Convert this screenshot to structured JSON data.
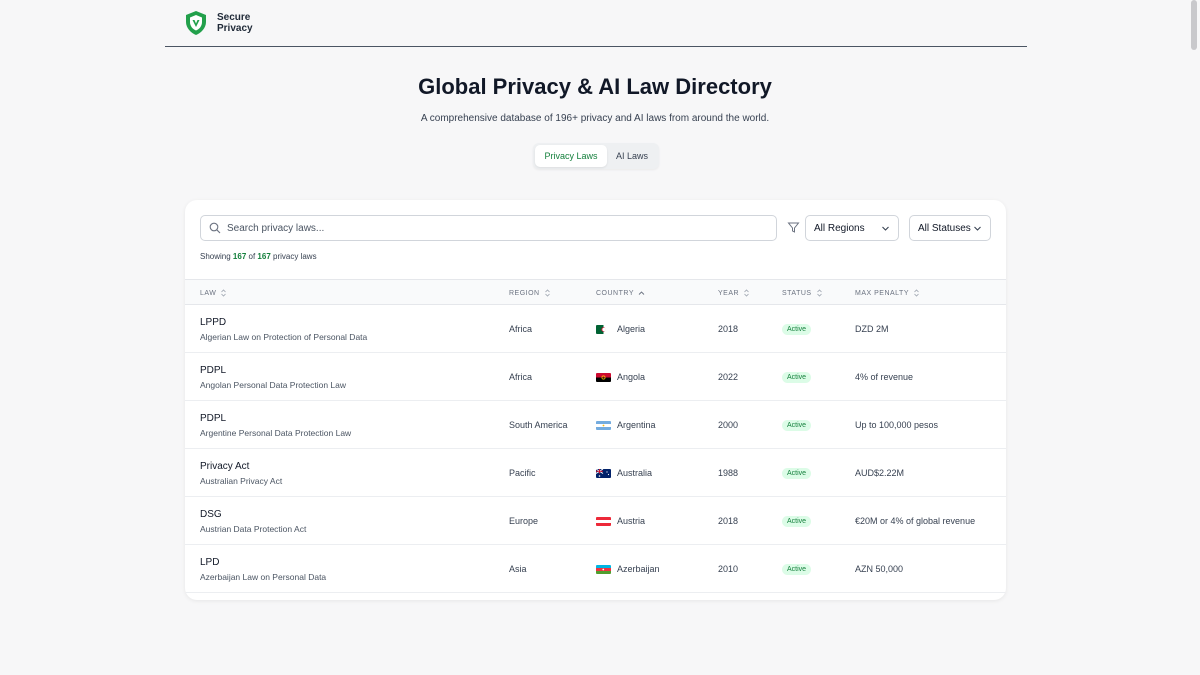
{
  "brand": {
    "line1": "Secure",
    "line2": "Privacy"
  },
  "hero": {
    "title": "Global Privacy & AI Law Directory",
    "subtitle": "A comprehensive database of 196+ privacy and AI laws from around the world."
  },
  "tabs": [
    {
      "label": "Privacy Laws",
      "active": true
    },
    {
      "label": "AI Laws",
      "active": false
    }
  ],
  "search": {
    "placeholder": "Search privacy laws..."
  },
  "filters": {
    "region": "All Regions",
    "status": "All Statuses"
  },
  "showing": {
    "prefix": "Showing",
    "shown": "167",
    "of": "of",
    "total": "167",
    "suffix": "privacy laws"
  },
  "columns": {
    "law": "LAW",
    "region": "REGION",
    "country": "COUNTRY",
    "year": "YEAR",
    "status": "STATUS",
    "penalty": "MAX PENALTY"
  },
  "colors": {
    "accent": "#15803d",
    "badge_bg": "#dcfce7"
  },
  "rows": [
    {
      "abbr": "LPPD",
      "name": "Algerian Law on Protection of Personal Data",
      "region": "Africa",
      "country": "Algeria",
      "flag": "algeria-flag",
      "year": "2018",
      "status": "Active",
      "penalty": "DZD 2M"
    },
    {
      "abbr": "PDPL",
      "name": "Angolan Personal Data Protection Law",
      "region": "Africa",
      "country": "Angola",
      "flag": "angola-flag",
      "year": "2022",
      "status": "Active",
      "penalty": "4% of revenue"
    },
    {
      "abbr": "PDPL",
      "name": "Argentine Personal Data Protection Law",
      "region": "South America",
      "country": "Argentina",
      "flag": "argentina-flag",
      "year": "2000",
      "status": "Active",
      "penalty": "Up to 100,000 pesos"
    },
    {
      "abbr": "Privacy Act",
      "name": "Australian Privacy Act",
      "region": "Pacific",
      "country": "Australia",
      "flag": "australia-flag",
      "year": "1988",
      "status": "Active",
      "penalty": "AUD$2.22M"
    },
    {
      "abbr": "DSG",
      "name": "Austrian Data Protection Act",
      "region": "Europe",
      "country": "Austria",
      "flag": "austria-flag",
      "year": "2018",
      "status": "Active",
      "penalty": "€20M or 4% of global revenue"
    },
    {
      "abbr": "LPD",
      "name": "Azerbaijan Law on Personal Data",
      "region": "Asia",
      "country": "Azerbaijan",
      "flag": "azerbaijan-flag",
      "year": "2010",
      "status": "Active",
      "penalty": "AZN 50,000"
    }
  ]
}
